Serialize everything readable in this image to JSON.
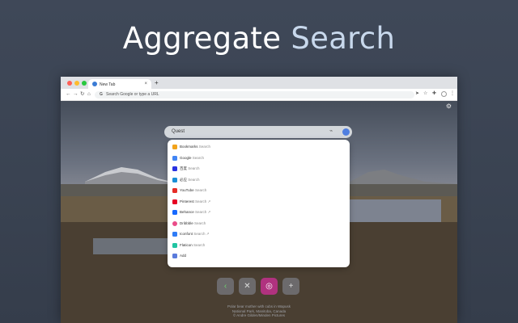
{
  "headline": {
    "part1": "Aggregate",
    "part2": "Search"
  },
  "browser": {
    "tab_title": "New Tab",
    "tab_close": "×",
    "new_tab": "+",
    "nav": {
      "back": "←",
      "forward": "→",
      "reload": "↻",
      "home": "⌂"
    },
    "omnibox": {
      "google_glyph": "G",
      "placeholder": "Search Google or type a URL"
    },
    "toolbar_icons": {
      "send": "➤",
      "star": "☆",
      "extensions": "✚"
    }
  },
  "page": {
    "settings_glyph": "⚙",
    "search": {
      "query": "Quest",
      "scan_glyph": "⌁"
    },
    "engines": [
      {
        "name": "Bookmarks",
        "suffix": "Search",
        "color": "#f2a31b"
      },
      {
        "name": "Google",
        "suffix": "Search",
        "color": "#4285f4"
      },
      {
        "name": "百度",
        "suffix": "Search",
        "color": "#2932e1"
      },
      {
        "name": "必应",
        "suffix": "Search",
        "color": "#1a8fd6"
      },
      {
        "name": "YouTube",
        "suffix": "Search",
        "color": "#e52d27"
      },
      {
        "name": "Pinterest",
        "suffix": "Search ↗",
        "color": "#e60023"
      },
      {
        "name": "Behance",
        "suffix": "Search ↗",
        "color": "#1769ff"
      },
      {
        "name": "Dribbble",
        "suffix": "Search",
        "color": "#ea4c89"
      },
      {
        "name": "Iconfont",
        "suffix": "Search ↗",
        "color": "#2f7cf6"
      },
      {
        "name": "Flaticon",
        "suffix": "Search",
        "color": "#21c4a2"
      },
      {
        "name": "Add",
        "suffix": "",
        "color": "#5a7bdc"
      }
    ],
    "dock": [
      {
        "glyph": "‹",
        "color": "#4a8f3a"
      },
      {
        "glyph": "✕",
        "color": "#7a7c80"
      },
      {
        "glyph": "◎",
        "color": "#c13584"
      },
      {
        "glyph": "+",
        "color": "#7a7c80"
      }
    ],
    "credit": {
      "line1": "Polar bear mother with cubs in Wapusk",
      "line2": "National Park, Manitoba, Canada",
      "line3": "© Andre Gilden/Minden Pictures"
    }
  }
}
